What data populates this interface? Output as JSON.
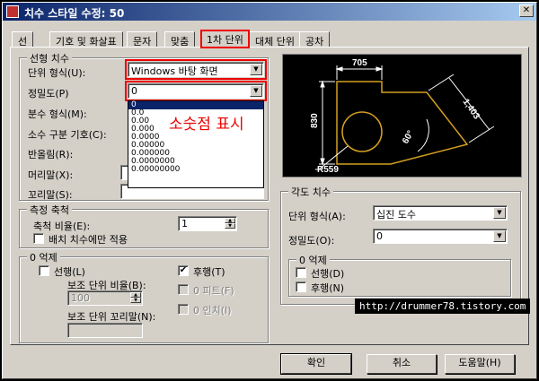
{
  "window": {
    "title": "치수 스타일 수정: 50",
    "close_glyph": "✕"
  },
  "tabs": [
    {
      "label": "선"
    },
    {
      "label": "기호 및 화살표"
    },
    {
      "label": "문자"
    },
    {
      "label": "맞춤"
    },
    {
      "label": "1차 단위"
    },
    {
      "label": "대체 단위"
    },
    {
      "label": "공차"
    }
  ],
  "linear": {
    "title": "선형 치수",
    "unit_format_label": "단위 형식(U):",
    "unit_format_value": "Windows 바탕 화면",
    "precision_label": "정밀도(P)",
    "precision_value": "0",
    "fraction_label": "분수 형식(M):",
    "decimal_sep_label": "소수 구분 기호(C):",
    "round_label": "반올림(R):",
    "prefix_label": "머리말(X):",
    "suffix_label": "꼬리말(S):",
    "precision_options": [
      "0",
      "0.0",
      "0.00",
      "0.000",
      "0.0000",
      "0.00000",
      "0.000000",
      "0.0000000",
      "0.00000000"
    ]
  },
  "annotation": "소숫점 표시",
  "measure_scale": {
    "title": "측정 축척",
    "scale_label": "축척 비율(E):",
    "scale_value": "1",
    "layout_only_label": "배치 치수에만 적용"
  },
  "zero_suppress_linear": {
    "title": "0 억제",
    "leading_label": "선행(L)",
    "trailing_label": "후행(T)",
    "trailing_checked": "✔",
    "sub_unit_factor_label": "보조 단위 비율(B):",
    "sub_unit_factor_value": "100",
    "zero_feet_label": "0 피트(F)",
    "sub_unit_suffix_label": "보조 단위 꼬리말(N):",
    "zero_inch_label": "0 인치(I)"
  },
  "preview": {
    "dim_top": "705",
    "dim_left": "830",
    "dim_right": "1,403",
    "angle": "60°",
    "radius": "R559"
  },
  "angular": {
    "title": "각도 치수",
    "unit_format_label": "단위 형식(A):",
    "unit_format_value": "십진 도수",
    "precision_label": "정밀도(O):",
    "precision_value": "0"
  },
  "zero_suppress_angular": {
    "title": "0 억제",
    "leading_label": "선행(D)",
    "trailing_label": "후행(N)"
  },
  "watermark": "http://drummer78.tistory.com",
  "buttons": {
    "ok": "확인",
    "cancel": "취소",
    "help": "도움말(H)"
  },
  "colors": {
    "preview_bg": "#000000",
    "preview_lines": "#ffffff",
    "preview_geometry": "#d4a020",
    "highlight": "#ee0000"
  }
}
